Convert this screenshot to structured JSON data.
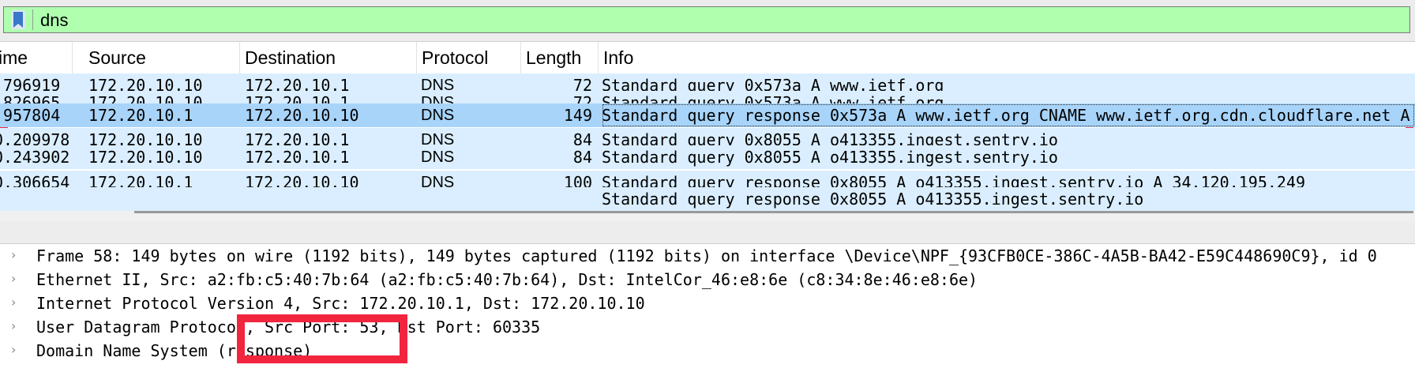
{
  "filter": {
    "value": "dns",
    "icon": "bookmark-icon",
    "background_color": "#afffaf"
  },
  "packet_list": {
    "columns": [
      "ime",
      "Source",
      "Destination",
      "Protocol",
      "Length",
      "Info"
    ],
    "rows": [
      {
        "time": ".796919",
        "source": "172.20.10.10",
        "destination": "172.20.10.1",
        "protocol": "DNS",
        "length": "72",
        "info": "Standard query 0x573a A www.ietf.org"
      },
      {
        "time": ".826965",
        "source": "172.20.10.10",
        "destination": "172.20.10.1",
        "protocol": "DNS",
        "length": "72",
        "info": "Standard query 0x573a A www.ietf.org"
      },
      {
        "time": ".957804",
        "source": "172.20.10.1",
        "destination": "172.20.10.10",
        "protocol": "DNS",
        "length": "149",
        "info": "Standard query response 0x573a A www.ietf.org CNAME www.ietf.org.cdn.cloudflare.net A"
      },
      {
        "time": "0.209978",
        "source": "172.20.10.10",
        "destination": "172.20.10.1",
        "protocol": "DNS",
        "length": "84",
        "info": "Standard query 0x8055 A o413355.ingest.sentry.io"
      },
      {
        "time": "0.243902",
        "source": "172.20.10.10",
        "destination": "172.20.10.1",
        "protocol": "DNS",
        "length": "84",
        "info": "Standard query 0x8055 A o413355.ingest.sentry.io"
      },
      {
        "time": "0.306654",
        "source": "172.20.10.1",
        "destination": "172.20.10.10",
        "protocol": "DNS",
        "length": "100",
        "info": "Standard query response 0x8055 A o413355.ingest.sentry.io A 34.120.195.249"
      },
      {
        "time": "",
        "source": "",
        "destination": "",
        "protocol": "",
        "length": "",
        "info": "Standard query response 0x8055 A o413355.ingest.sentry.io"
      }
    ],
    "selected_index": 2,
    "row_color": "#daeeff",
    "selected_color": "#a8d4fa"
  },
  "details": {
    "lines": [
      "Frame 58: 149 bytes on wire (1192 bits), 149 bytes captured (1192 bits) on interface \\Device\\NPF_{93CFB0CE-386C-4A5B-BA42-E59C448690C9}, id 0",
      "Ethernet II, Src: a2:fb:c5:40:7b:64 (a2:fb:c5:40:7b:64), Dst: IntelCor_46:e8:6e (c8:34:8e:46:e8:6e)",
      "Internet Protocol Version 4, Src: 172.20.10.1, Dst: 172.20.10.10",
      "User Datagram Protocol, Src Port: 53, Dst Port: 60335",
      "Domain Name System (response)"
    ],
    "expander_icon": "chevron-right-icon"
  },
  "highlight_color": "#f2253f"
}
